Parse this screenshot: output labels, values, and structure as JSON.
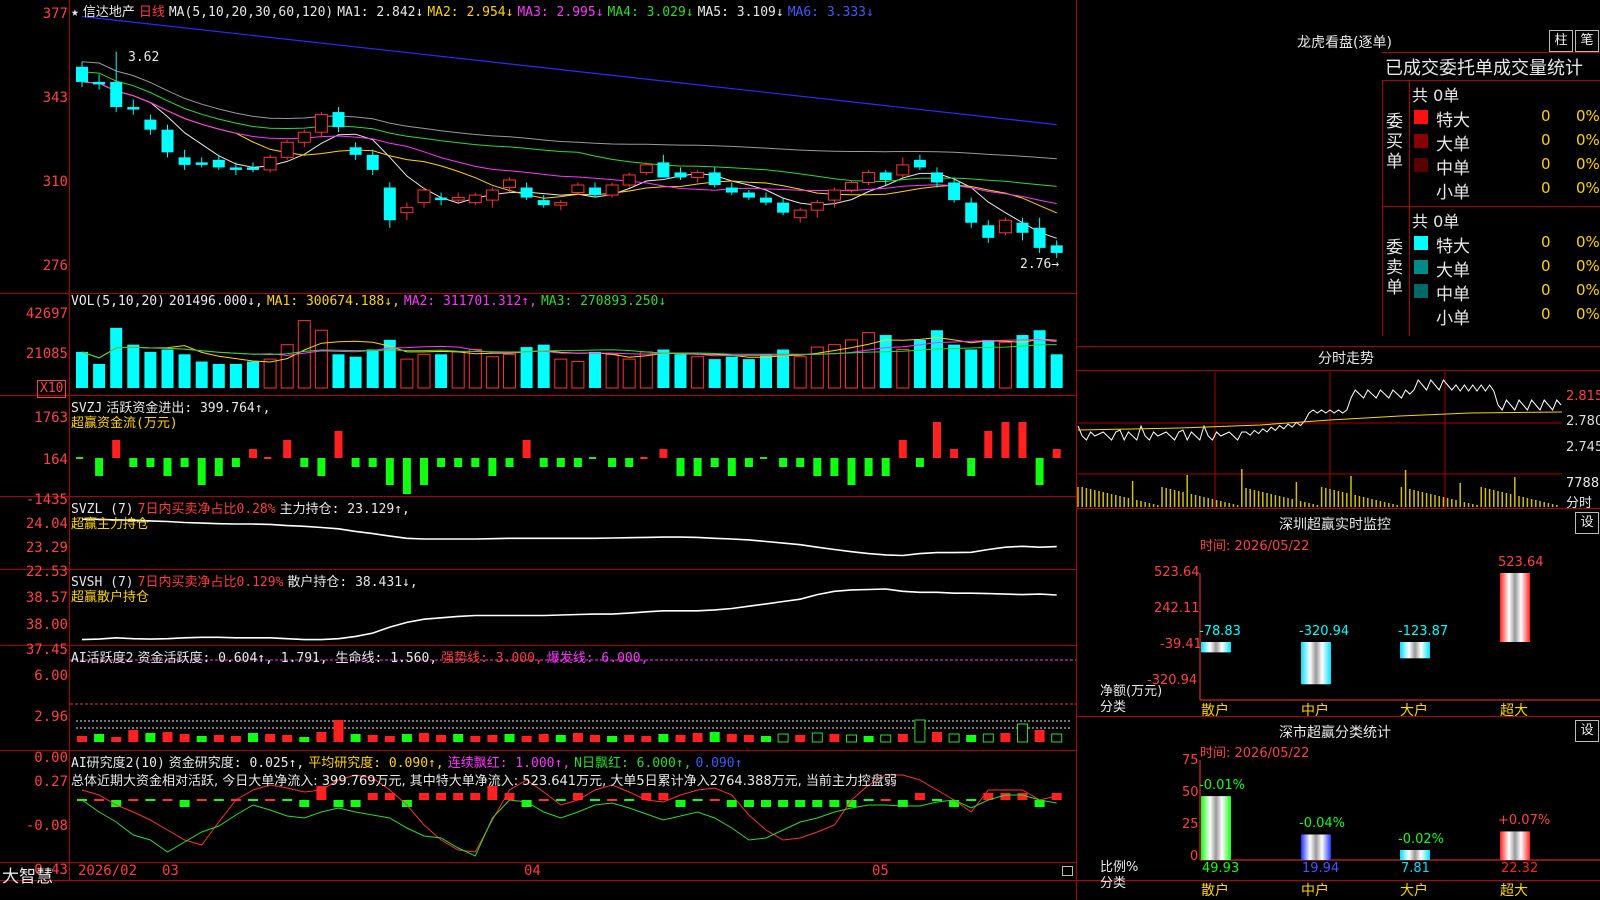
{
  "main_header": {
    "star": "★",
    "stock_name": "信达地产",
    "period": "日线",
    "ma_def": "MA(5,10,20,30,60,120)",
    "ma1": "MA1: 2.842↓",
    "ma2": "MA2: 2.954↓",
    "ma3": "MA3: 2.995↓",
    "ma4": "MA4: 3.029↓",
    "ma5": "MA5: 3.109↓",
    "ma6": "MA6: 3.333↓"
  },
  "price_axis": [
    "377",
    "343",
    "310",
    "276"
  ],
  "price_high_label": "3.62",
  "price_low_label": "2.76→",
  "vol_header": {
    "def": "VOL(5,10,20)",
    "value": "201496.000↓,",
    "ma1": "MA1: 300674.188↓,",
    "ma2": "MA2: 311701.312↑,",
    "ma3": "MA3: 270893.250↓"
  },
  "vol_axis": [
    "42697",
    "21085"
  ],
  "vol_unit": "X10",
  "svzj_header": {
    "name": "SVZJ",
    "label": "活跃资金进出: 399.764↑,",
    "sub": "超赢资金流(万元)"
  },
  "svzj_axis": [
    "1763",
    "164",
    "-1435"
  ],
  "svzl_header": {
    "name": "SVZL (7)",
    "ratio": "7日内买卖净占比0.28%",
    "label": "主力持仓: 23.129↑,",
    "sub": "超赢主力持仓"
  },
  "svzl_axis": [
    "24.04",
    "23.29",
    "22.53"
  ],
  "svsh_header": {
    "name": "SVSH (7)",
    "ratio": "7日内买卖净占比0.129%",
    "label": "散户持仓: 38.431↓,",
    "sub": "超赢散户持仓"
  },
  "svsh_axis": [
    "38.57",
    "38.00",
    "37.45"
  ],
  "ai1_header": {
    "name": "AI活跃度2",
    "label": "资金活跃度: 0.604↑, 1.791, 生命线: 1.560,",
    "strong": "强势线: 3.000,",
    "burst": "爆发线: 6.000,"
  },
  "ai1_axis": [
    "6.00",
    "2.96",
    "0.00"
  ],
  "ai2_header": {
    "name": "AI研究度2(10)",
    "label": "资金研究度: 0.025↑,",
    "avg": "平均研究度: 0.090↑,",
    "lianxu": "连续飘红: 1.000↑,",
    "nday": "N日飘红: 6.000↑,",
    "last": "0.090↑"
  },
  "ai2_summary": "总体近期大资金相对活跃, 今日大单净流入: 399.769万元, 其中特大单净流入: 523.641万元, 大单5日累计净入2764.388万元, 当前主力控盘弱",
  "ai2_axis": [
    "0.27",
    "-0.08",
    "-0.43"
  ],
  "bottom_bar": {
    "brand": "大智慧",
    "year": "2026/02",
    "m03": "03",
    "m04": "04",
    "m05": "05"
  },
  "right_panel": {
    "lhb_title": "龙虎看盘(逐单)",
    "btn_zhu": "柱",
    "btn_bi": "笔",
    "tabs_title": "已成交委托单成交量统计",
    "buy_side": "委买单",
    "sell_side": "委卖单",
    "buy_total": "共 0单",
    "sell_total": "共 0单",
    "buy_rows": [
      {
        "label": "特大",
        "count": "0",
        "pct": "0%",
        "color": "#ff1010"
      },
      {
        "label": "大单",
        "count": "0",
        "pct": "0%",
        "color": "#8a0000"
      },
      {
        "label": "中单",
        "count": "0",
        "pct": "0%",
        "color": "#5a0000"
      },
      {
        "label": "小单",
        "count": "0",
        "pct": "0%",
        "color": ""
      }
    ],
    "sell_rows": [
      {
        "label": "特大",
        "count": "0",
        "pct": "0%",
        "color": "#00ffff"
      },
      {
        "label": "大单",
        "count": "0",
        "pct": "0%",
        "color": "#008a8a"
      },
      {
        "label": "中单",
        "count": "0",
        "pct": "0%",
        "color": "#006868"
      },
      {
        "label": "小单",
        "count": "0",
        "pct": "0%",
        "color": ""
      }
    ],
    "intraday_title": "分时走势",
    "intraday_axis": [
      "2.815",
      "2.780",
      "2.745"
    ],
    "intraday_vol": "7788",
    "intraday_vol_unit": "分时",
    "sz_monitor_title": "深圳超赢实时监控",
    "sz_monitor_btn": "设",
    "sz_time": "时间: 2026/05/22",
    "sz_axis": [
      "523.64",
      "242.11",
      "-39.41",
      "-320.94"
    ],
    "sz_ylabel": "净额(万元)",
    "sz_xlabel": "分类",
    "sz_categories": [
      "散户",
      "中户",
      "大户",
      "超大"
    ],
    "sz_values": [
      "-78.83",
      "-320.94",
      "-123.87",
      "523.64"
    ],
    "cls_title": "深市超赢分类统计",
    "cls_btn": "设",
    "cls_time": "时间: 2026/05/22",
    "cls_axis": [
      "75",
      "50",
      "25",
      "0"
    ],
    "cls_ylabel": "比例%",
    "cls_xlabel": "分类",
    "cls_categories": [
      "散户",
      "中户",
      "大户",
      "超大"
    ],
    "cls_top": [
      "-0.01%",
      "-0.04%",
      "-0.02%",
      "+0.07%"
    ],
    "cls_values": [
      "49.93",
      "19.94",
      "7.81",
      "22.32"
    ]
  },
  "chart_data": [
    {
      "type": "candlestick",
      "title": "信达地产 日线",
      "ylim": [
        2.76,
        3.77
      ],
      "ohlc": [
        [
          3.56,
          3.58,
          3.48,
          3.5
        ],
        [
          3.5,
          3.53,
          3.47,
          3.49
        ],
        [
          3.5,
          3.62,
          3.38,
          3.4
        ],
        [
          3.4,
          3.43,
          3.37,
          3.39
        ],
        [
          3.35,
          3.37,
          3.29,
          3.31
        ],
        [
          3.31,
          3.33,
          3.2,
          3.22
        ],
        [
          3.2,
          3.23,
          3.15,
          3.17
        ],
        [
          3.18,
          3.2,
          3.16,
          3.17
        ],
        [
          3.19,
          3.21,
          3.15,
          3.16
        ],
        [
          3.16,
          3.18,
          3.13,
          3.15
        ],
        [
          3.16,
          3.18,
          3.14,
          3.15
        ],
        [
          3.15,
          3.21,
          3.14,
          3.2
        ],
        [
          3.2,
          3.27,
          3.19,
          3.26
        ],
        [
          3.26,
          3.31,
          3.24,
          3.3
        ],
        [
          3.3,
          3.38,
          3.28,
          3.37
        ],
        [
          3.38,
          3.4,
          3.3,
          3.32
        ],
        [
          3.24,
          3.26,
          3.19,
          3.21
        ],
        [
          3.21,
          3.23,
          3.13,
          3.15
        ],
        [
          3.08,
          3.1,
          2.92,
          2.95
        ],
        [
          2.98,
          3.02,
          2.95,
          3.0
        ],
        [
          3.02,
          3.08,
          3.0,
          3.07
        ],
        [
          3.04,
          3.06,
          3.01,
          3.03
        ],
        [
          3.03,
          3.06,
          3.02,
          3.04
        ],
        [
          3.02,
          3.06,
          3.01,
          3.05
        ],
        [
          3.03,
          3.08,
          3.0,
          3.07
        ],
        [
          3.08,
          3.12,
          3.06,
          3.11
        ],
        [
          3.08,
          3.1,
          3.03,
          3.04
        ],
        [
          3.03,
          3.05,
          3.0,
          3.01
        ],
        [
          3.01,
          3.03,
          2.99,
          3.02
        ],
        [
          3.06,
          3.1,
          3.05,
          3.09
        ],
        [
          3.08,
          3.1,
          3.04,
          3.05
        ],
        [
          3.05,
          3.1,
          3.04,
          3.09
        ],
        [
          3.09,
          3.14,
          3.08,
          3.13
        ],
        [
          3.14,
          3.18,
          3.13,
          3.17
        ],
        [
          3.18,
          3.21,
          3.16,
          3.12
        ],
        [
          3.14,
          3.16,
          3.11,
          3.12
        ],
        [
          3.12,
          3.15,
          3.1,
          3.14
        ],
        [
          3.14,
          3.16,
          3.08,
          3.09
        ],
        [
          3.08,
          3.1,
          3.05,
          3.06
        ],
        [
          3.06,
          3.07,
          3.03,
          3.04
        ],
        [
          3.04,
          3.06,
          3.01,
          3.02
        ],
        [
          3.02,
          3.04,
          2.97,
          2.98
        ],
        [
          2.96,
          3.0,
          2.94,
          2.99
        ],
        [
          2.99,
          3.03,
          2.96,
          3.02
        ],
        [
          3.03,
          3.08,
          3.0,
          3.07
        ],
        [
          3.07,
          3.11,
          3.06,
          3.1
        ],
        [
          3.1,
          3.15,
          3.09,
          3.14
        ],
        [
          3.14,
          3.15,
          3.09,
          3.11
        ],
        [
          3.13,
          3.2,
          3.12,
          3.17
        ],
        [
          3.19,
          3.21,
          3.15,
          3.16
        ],
        [
          3.14,
          3.16,
          3.08,
          3.1
        ],
        [
          3.1,
          3.12,
          3.02,
          3.03
        ],
        [
          3.02,
          3.04,
          2.92,
          2.94
        ],
        [
          2.93,
          2.95,
          2.86,
          2.88
        ],
        [
          2.9,
          2.96,
          2.89,
          2.95
        ],
        [
          2.94,
          2.96,
          2.87,
          2.9
        ],
        [
          2.92,
          2.96,
          2.82,
          2.84
        ],
        [
          2.85,
          2.87,
          2.8,
          2.82
        ]
      ]
    }
  ]
}
